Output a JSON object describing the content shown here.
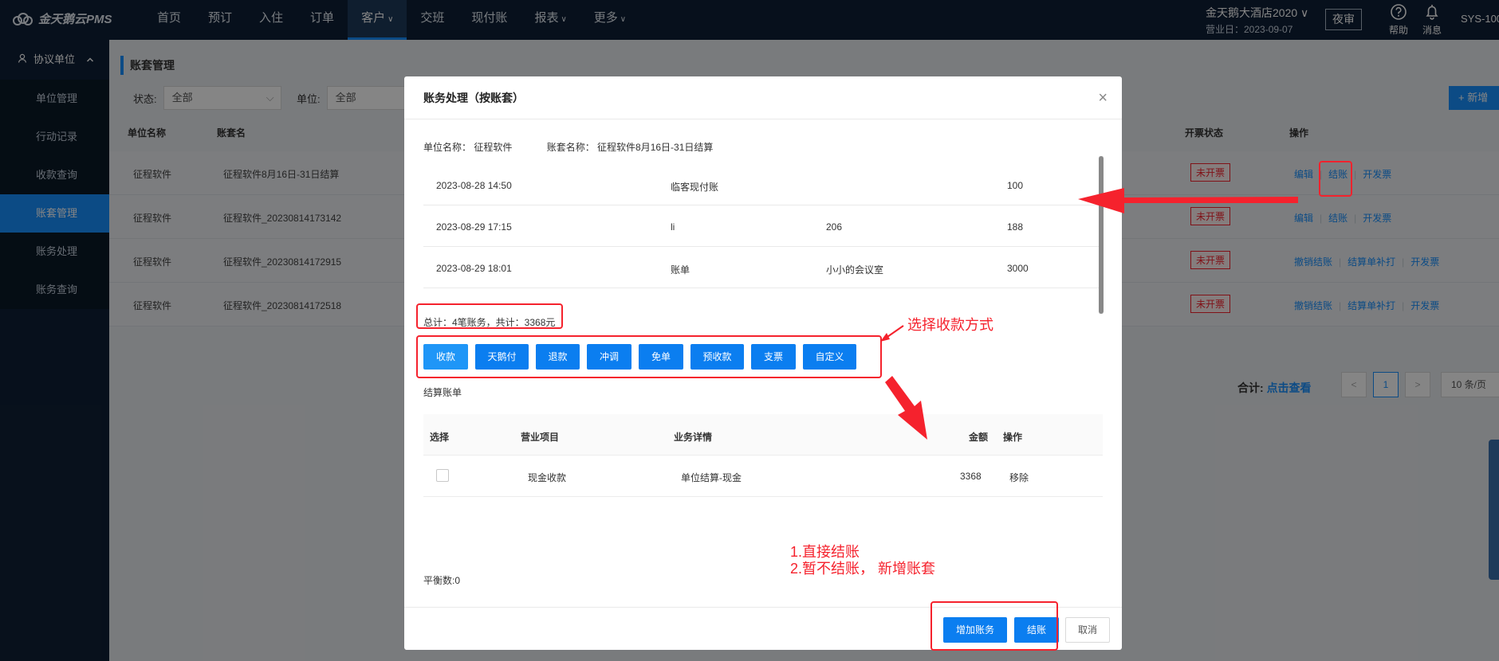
{
  "topbar": {
    "logo": "金天鹅云PMS",
    "nav": [
      "首页",
      "预订",
      "入住",
      "订单",
      "客户",
      "交班",
      "现付账",
      "报表",
      "更多"
    ],
    "nav_caret": "∨",
    "hotel_name": "金天鹅大酒店2020 ∨",
    "business_date": "营业日：2023-09-07",
    "night_audit": "夜审",
    "help": "帮助",
    "messages": "消息",
    "user": "SYS-100"
  },
  "sidebar": {
    "group": "协议单位",
    "items": [
      "单位管理",
      "行动记录",
      "收款查询",
      "账套管理",
      "账务处理",
      "账务查询"
    ]
  },
  "page": {
    "title": "账套管理",
    "status_label": "状态:",
    "status_value": "全部",
    "unit_label": "单位:",
    "unit_value": "全部",
    "add_button": "+ 新增",
    "columns": {
      "unit": "单位名称",
      "set": "账套名",
      "invoice": "开票状态",
      "ops": "操作"
    },
    "rows": [
      {
        "unit": "征程软件",
        "set": "征程软件8月16日-31日结算",
        "invoice": "未开票",
        "ops": [
          "编辑",
          "结账",
          "开发票"
        ]
      },
      {
        "unit": "征程软件",
        "set": "征程软件_20230814173142",
        "invoice": "未开票",
        "ops": [
          "编辑",
          "结账",
          "开发票"
        ]
      },
      {
        "unit": "征程软件",
        "set": "征程软件_20230814172915",
        "invoice": "未开票",
        "ops": [
          "撤销结账",
          "结算单补打",
          "开发票"
        ]
      },
      {
        "unit": "征程软件",
        "set": "征程软件_20230814172518",
        "invoice": "未开票",
        "ops": [
          "撤销结账",
          "结算单补打",
          "开发票"
        ]
      }
    ],
    "total_label": "合计:",
    "total_link": "点击查看",
    "prev": "<",
    "current_page": "1",
    "next": ">",
    "page_size": "10 条/页"
  },
  "modal": {
    "title": "账务处理（按账套）",
    "close": "×",
    "unit_name": "单位名称：  征程软件",
    "set_name": "账套名称：  征程软件8月16日-31日结算",
    "records": [
      {
        "time": "2023-08-28 14:50",
        "type": "临客现付账",
        "room": "",
        "amount": "100"
      },
      {
        "time": "2023-08-29 17:15",
        "type": "li",
        "room": "206",
        "amount": "188"
      },
      {
        "time": "2023-08-29 18:01",
        "type": "账单",
        "room": "小小的会议室",
        "amount": "3000"
      }
    ],
    "summary": "总计：4笔账务，共计：3368元",
    "pay_buttons": [
      "收款",
      "天鹅付",
      "退款",
      "冲调",
      "免单",
      "预收款",
      "支票",
      "自定义"
    ],
    "section_title": "结算账单",
    "settle_columns": {
      "select": "选择",
      "item": "营业项目",
      "detail": "业务详情",
      "amount": "金额",
      "ops": "操作"
    },
    "settle_rows": [
      {
        "item": "现金收款",
        "detail": "单位结算-现金",
        "amount": "3368",
        "op": "移除"
      }
    ],
    "balance": "平衡数:0",
    "buttons": {
      "add": "增加账务",
      "checkout": "结账",
      "cancel": "取消"
    }
  },
  "annotations": {
    "choose_payment": "选择收款方式",
    "note_1": "1.直接结账",
    "note_2": "2.暂不结账，  新增账套",
    "color": "#f5222d"
  }
}
